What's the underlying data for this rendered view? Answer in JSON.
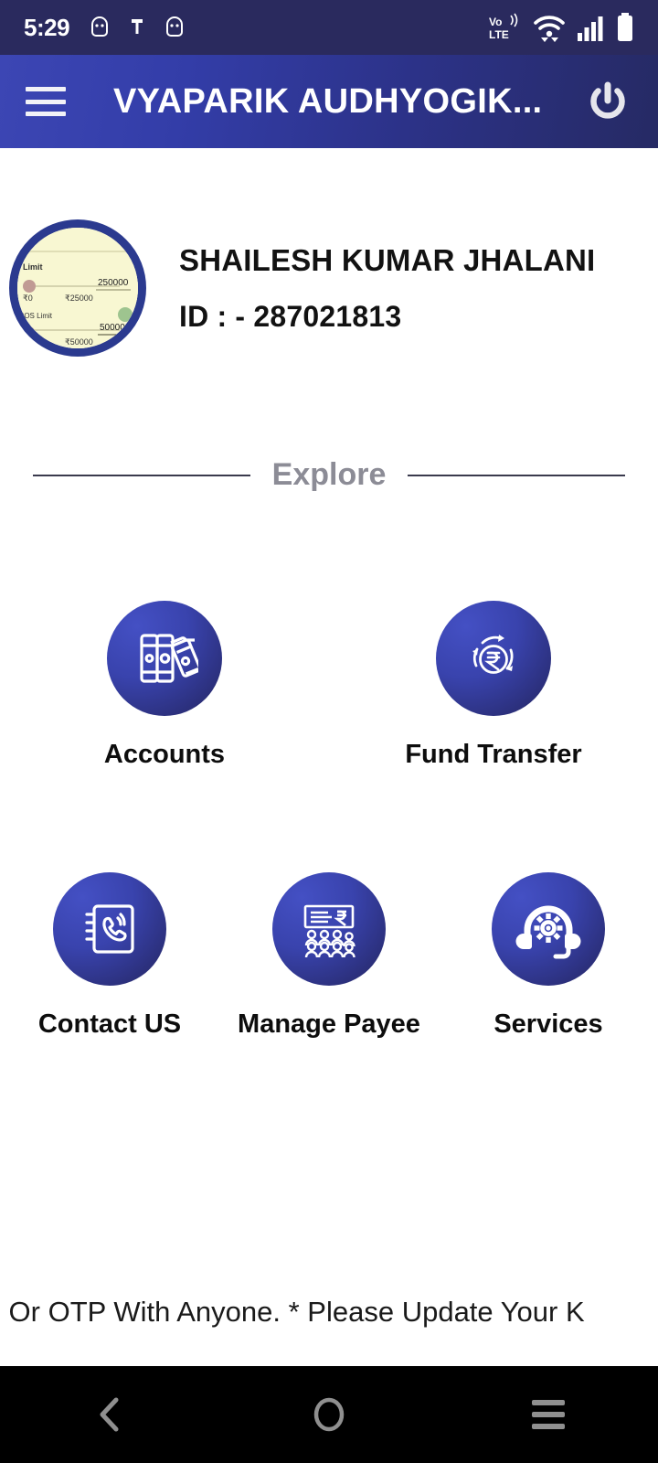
{
  "status_bar": {
    "time": "5:29",
    "left_icons": [
      "android-notification-icon",
      "pin-icon",
      "android-notification-icon"
    ],
    "network_label": "VoLTE",
    "right_icons": [
      "volte-icon",
      "wifi-icon",
      "signal-bars-icon",
      "battery-full-icon"
    ],
    "background_color": "#2a2a5e"
  },
  "app_bar": {
    "menu_icon": "hamburger-menu-icon",
    "title": "VYAPARIK AUDHYOGIK...",
    "power_icon": "power-logout-icon",
    "gradient_start": "#3c46b4",
    "gradient_end": "#262a64"
  },
  "profile": {
    "avatar_icon": "user-avatar-image",
    "avatar_border_color": "#2b3a8f",
    "avatar_background_color": "#f8f7d2",
    "name": "SHAILESH  KUMAR  JHALANI",
    "id": "ID : - 287021813"
  },
  "section": {
    "explore_label": "Explore",
    "divider_color": "#3a3a4d",
    "label_color": "#8c8c96"
  },
  "tiles": {
    "circle_gradient_start": "#4450c4",
    "circle_gradient_end": "#262a63",
    "row1": [
      {
        "label": "Accounts",
        "icon": "ledger-books-icon"
      },
      {
        "label": "Fund Transfer",
        "icon": "rupee-transfer-icon"
      }
    ],
    "row2": [
      {
        "label": "Contact US",
        "icon": "phone-book-icon"
      },
      {
        "label": "Manage Payee",
        "icon": "payee-cheque-people-icon"
      },
      {
        "label": "Services",
        "icon": "headset-gear-icon"
      }
    ]
  },
  "ticker": {
    "text": "redential Or OTP With Anyone. * Please Update Your K"
  },
  "nav_bar": {
    "back_icon": "back-chevron-icon",
    "home_icon": "home-circle-icon",
    "recents_icon": "recents-menu-icon",
    "background_color": "#000000",
    "icon_color": "#8f8f8f"
  }
}
